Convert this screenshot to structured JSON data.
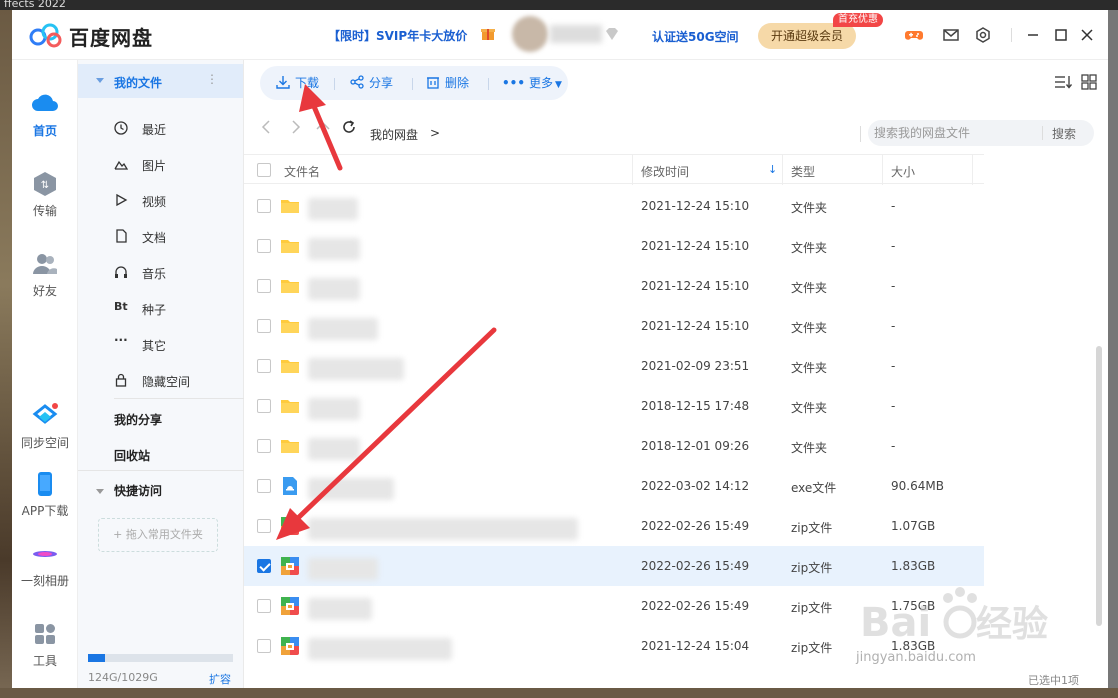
{
  "desktop": {
    "title": "ffects 2022"
  },
  "titlebar": {
    "app_name": "百度网盘",
    "promo": "【限时】SVIP年卡大放价",
    "cert_link": "认证送50G空间",
    "vip_button": "开通超级会员",
    "vip_badge": "首充优惠"
  },
  "leftnav": {
    "items": [
      {
        "label": "首页",
        "icon": "cloud-icon",
        "active": true
      },
      {
        "label": "传输",
        "icon": "transfer-icon"
      },
      {
        "label": "好友",
        "icon": "friends-icon"
      },
      {
        "label": "同步空间",
        "icon": "sync-icon"
      },
      {
        "label": "APP下载",
        "icon": "phone-icon"
      },
      {
        "label": "一刻相册",
        "icon": "album-icon"
      },
      {
        "label": "工具",
        "icon": "tools-icon"
      }
    ]
  },
  "categories": {
    "head": "我的文件",
    "items": [
      "最近",
      "图片",
      "视频",
      "文档",
      "音乐",
      "种子",
      "其它",
      "隐藏空间"
    ],
    "seed_icon_text": "Bt",
    "other_icon_text": "···",
    "my_share": "我的分享",
    "recycle": "回收站",
    "quick_access": "快捷访问",
    "drop_hint": "+ 拖入常用文件夹",
    "quota_text": "124G/1029G",
    "quota_expand": "扩容",
    "quota_used_fraction": 0.12
  },
  "toolbar": {
    "download": "下载",
    "share": "分享",
    "delete": "删除",
    "more": "更多"
  },
  "addressbar": {
    "crumb": "我的网盘",
    "crumb_sep": ">",
    "search_placeholder": "搜索我的网盘文件",
    "search_button": "搜索"
  },
  "table": {
    "headers": {
      "name": "文件名",
      "modified": "修改时间",
      "type": "类型",
      "size": "大小"
    },
    "rows": [
      {
        "date": "2021-12-24 15:10",
        "type": "文件夹",
        "size": "-",
        "kind": "folder",
        "selected": false
      },
      {
        "date": "2021-12-24 15:10",
        "type": "文件夹",
        "size": "-",
        "kind": "folder",
        "selected": false
      },
      {
        "date": "2021-12-24 15:10",
        "type": "文件夹",
        "size": "-",
        "kind": "folder",
        "selected": false
      },
      {
        "date": "2021-12-24 15:10",
        "type": "文件夹",
        "size": "-",
        "kind": "folder",
        "selected": false
      },
      {
        "date": "2021-02-09 23:51",
        "type": "文件夹",
        "size": "-",
        "kind": "folder",
        "selected": false
      },
      {
        "date": "2018-12-15 17:48",
        "type": "文件夹",
        "size": "-",
        "kind": "folder",
        "selected": false
      },
      {
        "date": "2018-12-01 09:26",
        "type": "文件夹",
        "size": "-",
        "kind": "folder",
        "selected": false
      },
      {
        "date": "2022-03-02 14:12",
        "type": "exe文件",
        "size": "90.64MB",
        "kind": "exe",
        "selected": false
      },
      {
        "date": "2022-02-26 15:49",
        "type": "zip文件",
        "size": "1.07GB",
        "kind": "zip",
        "selected": false
      },
      {
        "date": "2022-02-26 15:49",
        "type": "zip文件",
        "size": "1.83GB",
        "kind": "zip",
        "selected": true
      },
      {
        "date": "2022-02-26 15:49",
        "type": "zip文件",
        "size": "1.75GB",
        "kind": "zip",
        "selected": false
      },
      {
        "date": "2021-12-24 15:04",
        "type": "zip文件",
        "size": "1.83GB",
        "kind": "zip",
        "selected": false
      }
    ]
  },
  "status": {
    "selected_count": "已选中1项"
  },
  "watermark": {
    "brand": "Baidu经验",
    "url": "jingyan.baidu.com"
  },
  "colors": {
    "accent": "#1a76e3",
    "annotation": "#e8383d",
    "selected_row": "#e8f2fd"
  }
}
